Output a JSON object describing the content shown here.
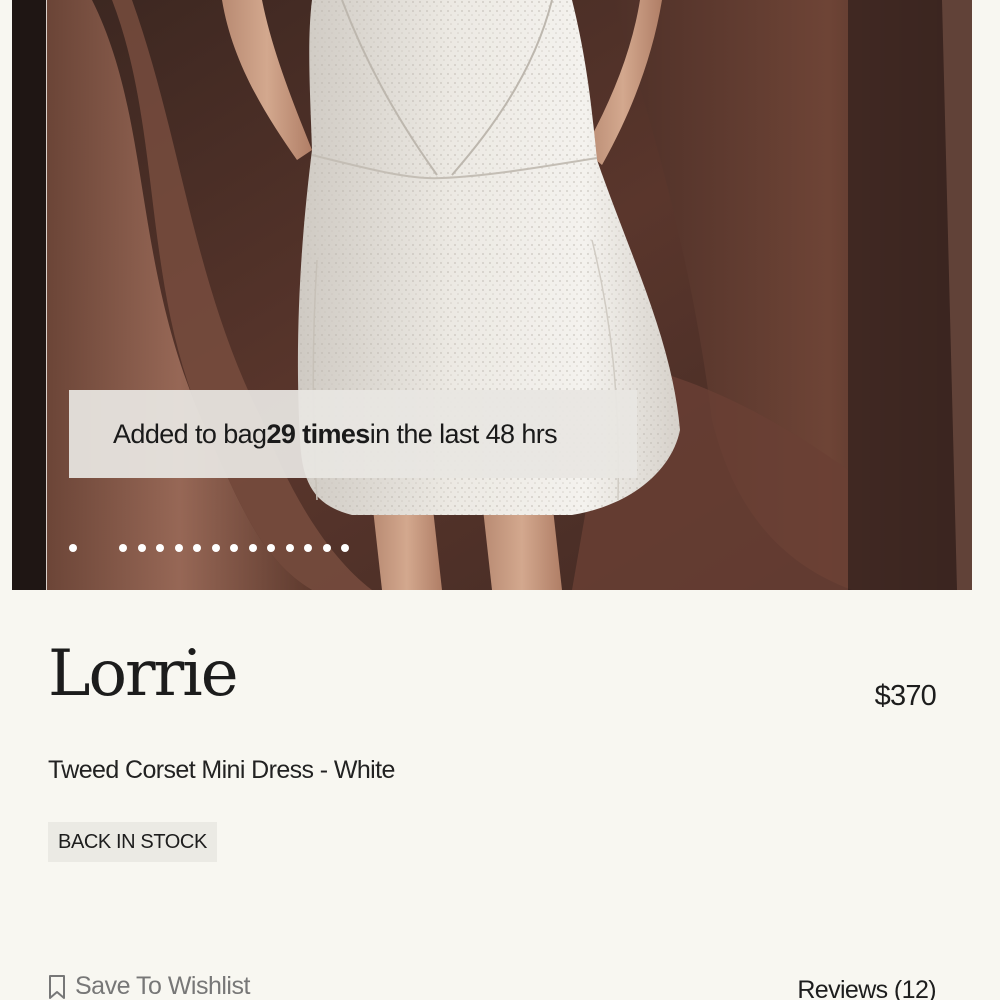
{
  "hero": {
    "toast": {
      "prefix": "Added to bag ",
      "highlight": "29 times",
      "suffix": " in the last 48 hrs"
    },
    "carousel": {
      "slide_count": 14,
      "active_index": 0
    }
  },
  "product": {
    "name": "Lorrie",
    "price": "$370",
    "subtitle": "Tweed Corset Mini Dress - White",
    "badge": "BACK IN STOCK"
  },
  "actions": {
    "wishlist_label": "Save To Wishlist",
    "wishlist_icon": "bookmark-icon",
    "reviews_label": "Reviews (12)"
  },
  "colors": {
    "page_background": "#f8f7f1",
    "badge_background": "#ebeae4",
    "text_primary": "#1d1d1d",
    "text_muted": "#777777"
  }
}
